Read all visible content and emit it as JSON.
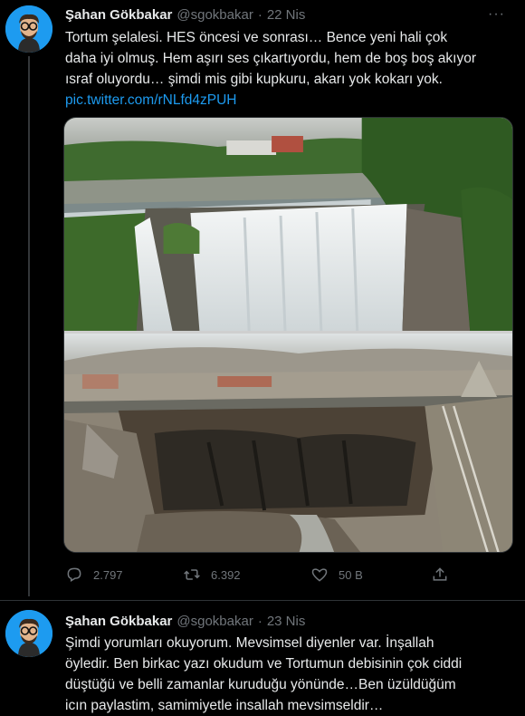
{
  "tweets": [
    {
      "author": {
        "name": "Şahan Gökbakar",
        "handle": "@sgokbakar"
      },
      "date": "22 Nis",
      "text_lines": [
        "Tortum şelalesi. HES öncesi ve sonrası… Bence yeni hali çok",
        "daha iyi olmuş. Hem aşırı ses çıkartıyordu, hem de boş boş akıyor",
        "ısraf oluyordu… şimdi mis gibi kupkuru, akarı yok kokarı yok."
      ],
      "link": "pic.twitter.com/rNLfd4zPUH",
      "stats": {
        "replies": "2.797",
        "retweets": "6.392",
        "likes": "50 B"
      }
    },
    {
      "author": {
        "name": "Şahan Gökbakar",
        "handle": "@sgokbakar"
      },
      "date": "23 Nis",
      "text_lines": [
        "Şimdi yorumları okuyorum. Mevsimsel diyenler var. İnşallah",
        "öyledir. Ben birkac yazı okudum ve Tortumun debisinin çok ciddi",
        "düştüğü ve belli zamanlar kuruduğu yönünde…Ben üzüldüğüm",
        "icın paylastim, samimiyetle insallah mevsimseldir…"
      ]
    }
  ],
  "ui": {
    "dot": "·",
    "more": "···"
  },
  "icons": {
    "reply": "comment-icon",
    "retweet": "retweet-icon",
    "like": "heart-icon",
    "share": "share-icon"
  },
  "colors": {
    "background": "#000000",
    "text": "#e7e9ea",
    "muted": "#71767b",
    "link": "#1d9bf0"
  }
}
